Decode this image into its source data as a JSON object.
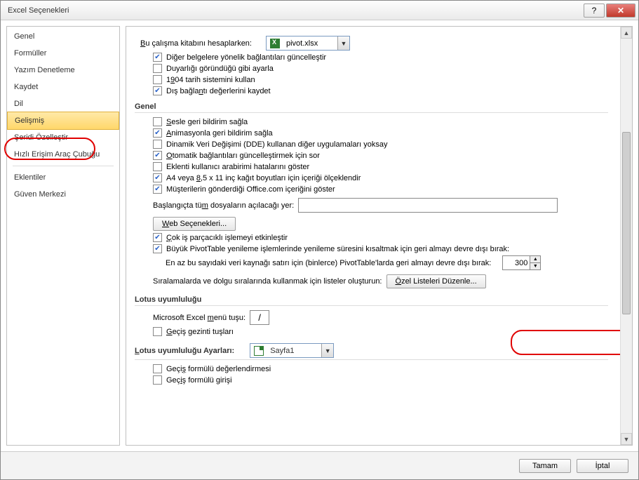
{
  "window": {
    "title": "Excel Seçenekleri"
  },
  "sidebar": {
    "items": [
      {
        "label": "Genel"
      },
      {
        "label": "Formüller"
      },
      {
        "label": "Yazım Denetleme"
      },
      {
        "label": "Kaydet"
      },
      {
        "label": "Dil"
      },
      {
        "label": "Gelişmiş"
      },
      {
        "label": "Şeridi Özelleştir"
      },
      {
        "label": "Hızlı Erişim Araç Çubuğu"
      },
      {
        "label": "Eklentiler"
      },
      {
        "label": "Güven Merkezi"
      }
    ]
  },
  "workbook_calc": {
    "label_pre": "B",
    "label_post": "u çalışma kitabını hesaplarken:",
    "selected": "pivot.xlsx",
    "opts": [
      {
        "checked": true,
        "text": "Diğer belgelere yönelik bağlantıları güncelleştir",
        "u": "y"
      },
      {
        "checked": false,
        "text": "Duyarlığı göründüğü gibi ayarla"
      },
      {
        "checked": false,
        "text_pre": "1",
        "u": "9",
        "text_post": "04 tarih sistemini kullan"
      },
      {
        "checked": true,
        "text_pre": "Dış bağla",
        "u": "n",
        "text_post": "tı değerlerini kaydet"
      }
    ]
  },
  "general": {
    "header": "Genel",
    "opts": [
      {
        "checked": false,
        "u": "S",
        "text": "esle geri bildirim sağla"
      },
      {
        "checked": true,
        "u": "A",
        "text": "nimasyonla geri bildirim sağla"
      },
      {
        "checked": false,
        "text": "Dinamik Veri Değişimi (DDE) kullanan diğer uygulamaları yoksay"
      },
      {
        "checked": true,
        "u": "O",
        "text": "tomatik bağlantıları güncelleştirmek için sor"
      },
      {
        "checked": false,
        "text": "Eklenti kullanıcı arabirimi hatalarını göster"
      },
      {
        "checked": true,
        "text_pre": "A4 veya ",
        "u": "8",
        "text_post": ",5 x 11 inç kağıt boyutları için içeriği ölçeklendir"
      },
      {
        "checked": true,
        "text": "Müşterilerin gönderdiği Office.com içeriğini göster"
      }
    ],
    "startup_label_pre": "Başlangıçta tü",
    "startup_u": "m",
    "startup_label_post": " dosyaların açılacağı yer:",
    "startup_value": "",
    "web_btn": "Web Seçenekleri...",
    "multithread": {
      "checked": true,
      "u": "Ç",
      "text": "ok iş parçacıklı işlemeyi etkinleştir"
    },
    "pivot_refresh": {
      "checked": true,
      "text": "Büyük PivotTable yenileme işlemlerinde yenileme süresini kısaltmak için geri almayı devre dışı bırak:"
    },
    "pivot_rows_label": "En az bu sayıdaki veri kaynağı satırı için (binlerce) PivotTable'larda geri almayı devre dışı bırak:",
    "pivot_rows_value": "300",
    "custom_lists_label": "Sıralamalarda ve dolgu sıralarında kullanmak için listeler oluşturun:",
    "custom_lists_btn_u": "Ö",
    "custom_lists_btn": "zel Listeleri Düzenle..."
  },
  "lotus": {
    "header": "Lotus uyumluluğu",
    "menu_key_label_pre": "Microsoft Excel ",
    "menu_key_u": "m",
    "menu_key_label_post": "enü tuşu:",
    "menu_key_value": "/",
    "nav_keys": {
      "checked": false,
      "u": "G",
      "text": "eçiş gezinti tuşları"
    }
  },
  "lotus_settings": {
    "header_u": "L",
    "header": "otus uyumluluğu Ayarları:",
    "selected": "Sayfa1",
    "eval": {
      "checked": false,
      "text_pre": "Geçi",
      "u": "ş",
      "text_post": " formülü değerlendirmesi"
    },
    "entry": {
      "checked": false,
      "text_pre": "Geç",
      "u": "i",
      "text_post": "ş formülü girişi"
    }
  },
  "footer": {
    "ok": "Tamam",
    "cancel": "İptal"
  }
}
